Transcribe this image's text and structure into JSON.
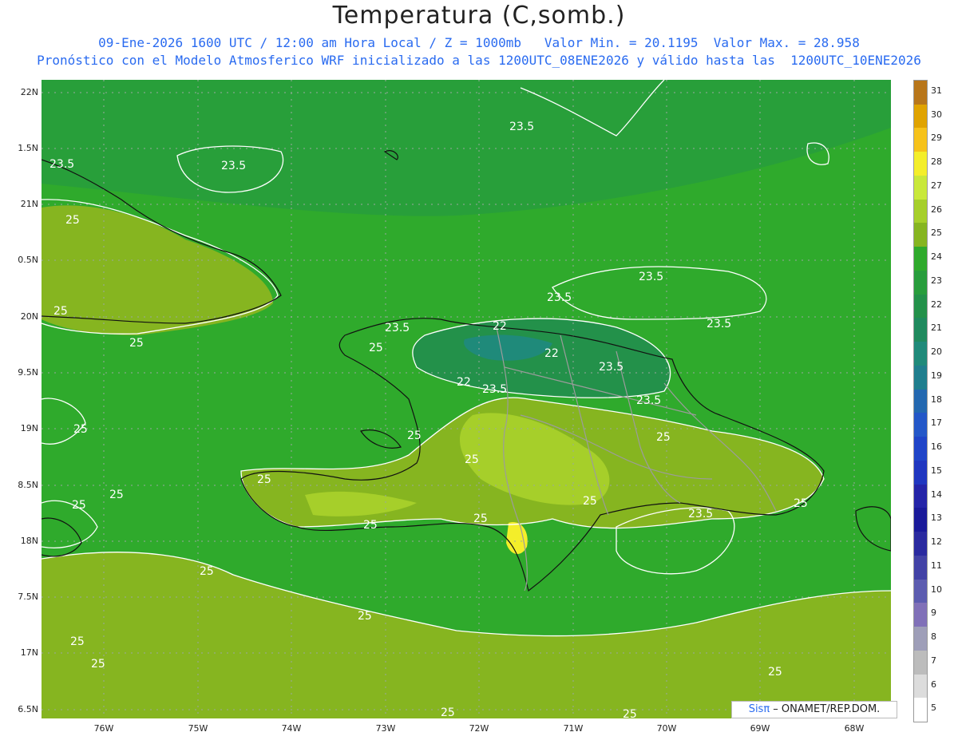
{
  "header": {
    "title": "Temperatura (C,somb.)",
    "line1": "09-Ene-2026 1600 UTC / 12:00 am Hora Local / Z = 1000mb   Valor Min. = 20.1195  Valor Max. = 28.958",
    "line2": "Pronóstico con el Modelo Atmosferico WRF inicializado a las 1200UTC_08ENE2026 y válido hasta las  1200UTC_10ENE2026"
  },
  "axes": {
    "lat_labels": [
      "22N",
      "1.5N",
      "21N",
      "0.5N",
      "20N",
      "9.5N",
      "19N",
      "8.5N",
      "18N",
      "7.5N",
      "17N",
      "6.5N"
    ],
    "lon_labels": [
      "76W",
      "75W",
      "74W",
      "73W",
      "72W",
      "71W",
      "70W",
      "69W",
      "68W"
    ]
  },
  "colorbar": {
    "labels": [
      "31",
      "30",
      "29",
      "28",
      "27",
      "26",
      "25",
      "24",
      "23",
      "22",
      "21",
      "20",
      "19",
      "18",
      "17",
      "16",
      "15",
      "14",
      "13",
      "12",
      "11",
      "10",
      "9",
      "8",
      "7",
      "6",
      "5"
    ],
    "colors": [
      "#b8761a",
      "#e0a300",
      "#f6c21a",
      "#f4ee2a",
      "#c9e83a",
      "#a6cf2a",
      "#86b520",
      "#2faa2c",
      "#289d3c",
      "#23914a",
      "#1f8a5e",
      "#1f8a7a",
      "#1f7e8e",
      "#2368b0",
      "#2357c8",
      "#1f44c8",
      "#1f36c0",
      "#2424a8",
      "#1a1a9a",
      "#2a2aa0",
      "#4242a6",
      "#5c5cb0",
      "#8070b8",
      "#9e9eb8",
      "#bcbcbc",
      "#dcdcdc",
      "#ffffff"
    ]
  },
  "contours": {
    "label_25": "25",
    "label_23_5": "23.5",
    "label_22": "22"
  },
  "credit": {
    "logo": "Sisπ",
    "text": " – ONAMET/REP.DOM."
  }
}
